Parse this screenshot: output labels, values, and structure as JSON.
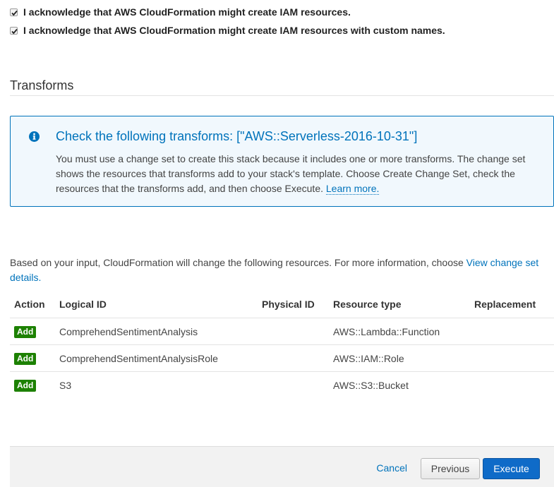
{
  "acknowledgements": [
    {
      "label": "I acknowledge that AWS CloudFormation might create IAM resources.",
      "checked": true
    },
    {
      "label": "I acknowledge that AWS CloudFormation might create IAM resources with custom names.",
      "checked": true
    }
  ],
  "transforms": {
    "section_title": "Transforms",
    "info_icon": "info-icon",
    "info_title": "Check the following transforms: [\"AWS::Serverless-2016-10-31\"]",
    "info_body": "You must use a change set to create this stack because it includes one or more transforms. The change set shows the resources that transforms add to your stack's template. Choose Create Change Set, check the resources that the transforms add, and then choose Execute.",
    "learn_more": "Learn more."
  },
  "changes": {
    "intro_text": "Based on your input, CloudFormation will change the following resources. For more information, choose",
    "intro_link": "View change set details.",
    "columns": [
      "Action",
      "Logical ID",
      "Physical ID",
      "Resource type",
      "Replacement"
    ],
    "rows": [
      {
        "action": "Add",
        "logical_id": "ComprehendSentimentAnalysis",
        "physical_id": "",
        "resource_type": "AWS::Lambda::Function",
        "replacement": ""
      },
      {
        "action": "Add",
        "logical_id": "ComprehendSentimentAnalysisRole",
        "physical_id": "",
        "resource_type": "AWS::IAM::Role",
        "replacement": ""
      },
      {
        "action": "Add",
        "logical_id": "S3",
        "physical_id": "",
        "resource_type": "AWS::S3::Bucket",
        "replacement": ""
      }
    ]
  },
  "footer": {
    "cancel_label": "Cancel",
    "previous_label": "Previous",
    "execute_label": "Execute"
  },
  "colors": {
    "link": "#0073bb",
    "badge_add": "#1d8102",
    "primary_button": "#0f6bc8",
    "info_background": "#f1f8fd"
  }
}
